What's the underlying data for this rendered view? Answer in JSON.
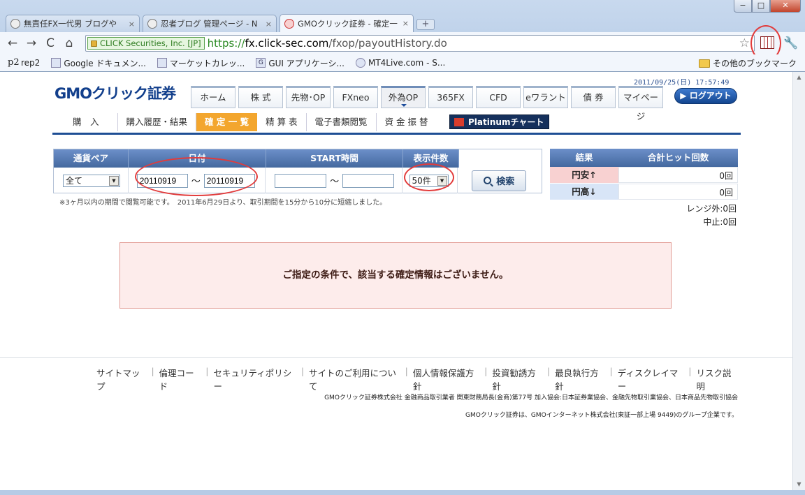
{
  "window": {
    "minimize": "−",
    "maximize": "□",
    "close": "✕"
  },
  "tabs": [
    {
      "title": "無責任FX一代男 ブログや",
      "close": "×",
      "icon": "globe-icon"
    },
    {
      "title": "忍者ブログ 管理ページ - N",
      "close": "×",
      "icon": "globe-icon"
    },
    {
      "title": "GMOクリック証券 - 確定一",
      "close": "×",
      "icon": "gmo-favicon",
      "active": true
    }
  ],
  "new_tab": "+",
  "toolbar": {
    "back": "←",
    "forward": "→",
    "reload": "C",
    "home": "⌂",
    "ssl_label": "CLICK Securities, Inc. [JP]",
    "url_scheme": "https://",
    "url_host": "fx.click-sec.com",
    "url_path": "/fxop/payoutHistory.do",
    "star": "☆",
    "wrench": "🔧"
  },
  "bookmarks": [
    {
      "label": "rep2",
      "icon": "p2"
    },
    {
      "label": "Google ドキュメン...",
      "icon": "doc-icon"
    },
    {
      "label": "マーケットカレッ...",
      "icon": "chart-icon"
    },
    {
      "label": "GUI アプリケーシ...",
      "icon": "G"
    },
    {
      "label": "MT4Live.com - S...",
      "icon": "globe-icon"
    }
  ],
  "other_bookmarks": "その他のブックマーク",
  "page": {
    "datetime": "2011/09/25(日) 17:57:49",
    "logo": "GMOクリック証券",
    "main_nav": [
      "ホーム",
      "株 式",
      "先物･OP",
      "FXneo",
      "外為OP",
      "365FX",
      "CFD",
      "eワラント",
      "債 券",
      "マイページ"
    ],
    "main_nav_active": "外為OP",
    "logout": "ログアウト",
    "sub_nav": [
      "購　入",
      "購入履歴・結果",
      "確 定 一 覧",
      "精 算 表",
      "電子書類閲覧",
      "資 金 振 替"
    ],
    "sub_nav_active": "確 定 一 覧",
    "platinum": "Platinumチャート",
    "form": {
      "headers": [
        "通貨ペア",
        "日付",
        "START時間",
        "表示件数"
      ],
      "pair_value": "全て",
      "date_from": "20110919",
      "date_to": "20110919",
      "tilde": "〜",
      "start_from": "",
      "start_to": "",
      "count_value": "50件",
      "search_label": "検索"
    },
    "note": "※3ヶ月以内の期間で閲覧可能です。　2011年6月29日より、取引期間を15分から10分に短縮しました。",
    "results": {
      "headers": [
        "結果",
        "合計ヒット回数"
      ],
      "rows": [
        {
          "label": "円安↑",
          "value": "0回"
        },
        {
          "label": "円高↓",
          "value": "0回"
        }
      ],
      "range_out": "レンジ外:0回",
      "cancelled": "中止:0回"
    },
    "alert": "ご指定の条件で、該当する確定情報はございません。",
    "footer_links": [
      "サイトマップ",
      "倫理コード",
      "セキュリティポリシー",
      "サイトのご利用について",
      "個人情報保護方針",
      "投資勧誘方針",
      "最良執行方針",
      "ディスクレイマー",
      "リスク説明"
    ],
    "footer_note1": "GMOクリック証券株式会社 金融商品取引業者 関東財務局長(金商)第77号 加入協会:日本証券業協会、金融先物取引業協会、日本商品先物取引協会",
    "footer_note2": "GMOクリック証券は、GMOインターネット株式会社(東証一部上場 9449)のグループ企業です。"
  },
  "colors": {
    "brand_blue": "#123f8c",
    "active_orange": "#f3a62e",
    "annotation_red": "#e23b3b",
    "alert_bg": "#fdeceb"
  }
}
